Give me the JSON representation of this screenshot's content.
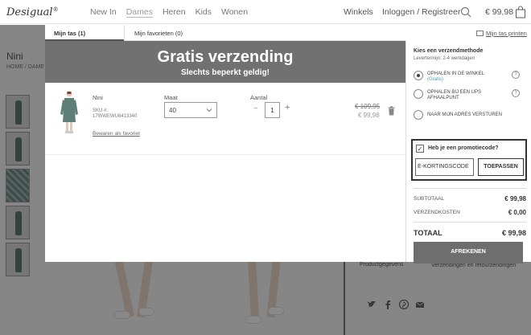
{
  "header": {
    "logo": "Desigual",
    "logo_mark": "®",
    "nav": [
      "New In",
      "Dames",
      "Heren",
      "Kids",
      "Wonen"
    ],
    "winkels": "Winkels",
    "login": "Inloggen / Registreer",
    "cart_total": "€ 99,98"
  },
  "background": {
    "product_title": "Nini",
    "breadcrumb": "HOME  /  DAME",
    "link_details": "Productgegevens",
    "link_shipping": "Verzendingen en retourzendingen"
  },
  "modal": {
    "tabs": [
      "Mijn tas (1)",
      "Mijn favorieten (0)"
    ],
    "print": "Mijn tas printen",
    "banner_title": "Gratis verzending",
    "banner_sub": "Slechts beperkt geldig!",
    "item": {
      "name": "Nini",
      "sku": "SKU #: 17WWEWU8413340",
      "save_fav": "Bewaren als favoriet",
      "size_label": "Maat",
      "size_value": "40",
      "qty_label": "Aantal",
      "qty_value": "1",
      "minus": "−",
      "plus": "+",
      "old_price": "€ 109,95",
      "new_price": "€ 99,98"
    }
  },
  "side": {
    "ship_heading": "Kies een verzendmethode",
    "ship_sub": "Levertermijn: 2-4 werkdagen",
    "options": [
      {
        "label": "OPHALEN IN DE WINKEL",
        "sub": "(Gratis)"
      },
      {
        "label": "OPHALEN BIJ EEN UPS AFHAALPUNT",
        "sub": ""
      },
      {
        "label": "NAAR MIJN ADRES VERSTUREN",
        "sub": ""
      }
    ],
    "help": "?",
    "promo_label": "Heb je een promotiecode?",
    "promo_input": "E-KORTINGSCODE",
    "promo_button": "TOEPASSEN",
    "check_mark": "✓",
    "subtotal_label": "SUBTOTAAL",
    "subtotal_value": "€ 99,98",
    "shipping_label": "VERZENDKOSTEN",
    "shipping_value": "€ 0,00",
    "total_label": "TOTAAL",
    "total_value": "€ 99,98",
    "checkout": "AFREKENEN"
  }
}
